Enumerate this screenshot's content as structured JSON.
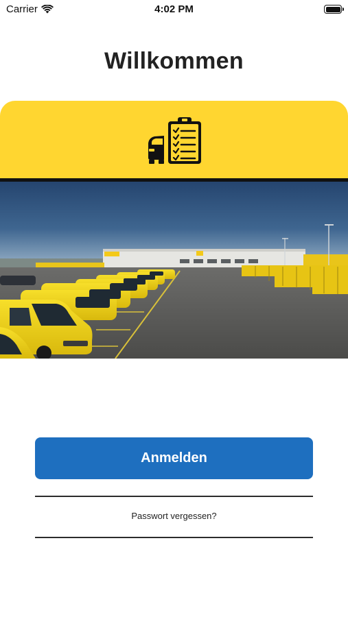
{
  "status_bar": {
    "carrier": "Carrier",
    "time": "4:02 PM"
  },
  "welcome": {
    "title": "Willkommen"
  },
  "banner": {
    "color": "#ffd630",
    "icon": "car-clipboard-icon"
  },
  "hero_image": {
    "description_icon": "depot-photo"
  },
  "actions": {
    "login_label": "Anmelden",
    "forgot_password_label": "Passwort vergessen?"
  },
  "colors": {
    "accent": "#1e6fbf",
    "brand_yellow": "#ffd630",
    "text": "#222222"
  }
}
